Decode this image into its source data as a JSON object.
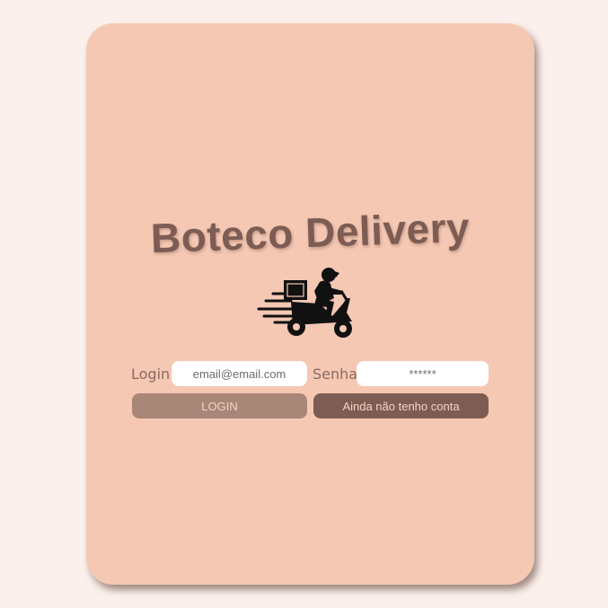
{
  "app": {
    "title": "Boteco Delivery",
    "logo_icon": "delivery-scooter-icon"
  },
  "form": {
    "login_label": "Login",
    "login_placeholder": "email@email.com",
    "senha_label": "Senha",
    "senha_placeholder": "******",
    "login_button": "LOGIN",
    "signup_button": "Ainda não tenho conta"
  },
  "colors": {
    "background": "#fbf0ec",
    "card": "#f5c8b3",
    "title": "#7d5d53",
    "login_button": "#a88678",
    "signup_button": "#7d5d53"
  }
}
